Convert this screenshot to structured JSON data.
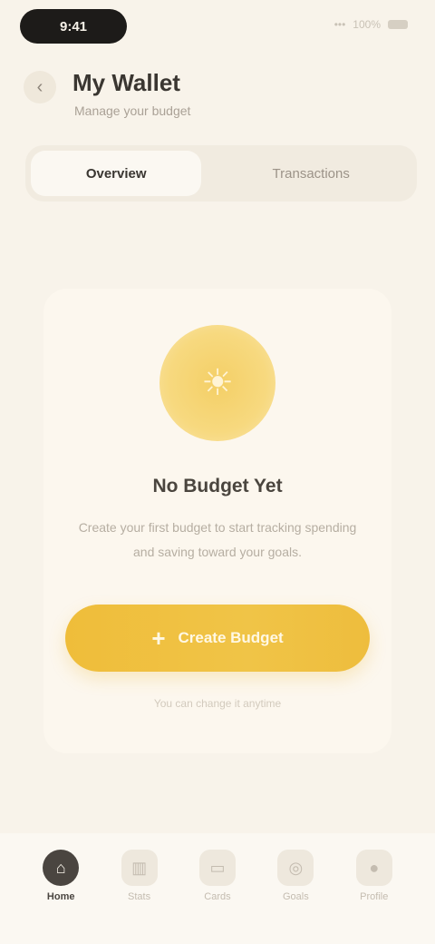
{
  "status": {
    "time": "9:41",
    "signal": "•••",
    "battery": "100%"
  },
  "header": {
    "back_icon": "chevron-left-icon",
    "title": "My Wallet",
    "subtitle": "Manage your budget"
  },
  "tabs": [
    {
      "label": "Overview",
      "active": true
    },
    {
      "label": "Transactions",
      "active": false
    }
  ],
  "empty_state": {
    "icon": "sun-icon",
    "title": "No Budget Yet",
    "description": "Create your first budget to start tracking spending and saving toward your goals.",
    "cta_label": "Create Budget",
    "cta_icon": "plus-icon",
    "note": "You can change it anytime"
  },
  "nav": [
    {
      "label": "Home",
      "icon": "home-icon",
      "active": true
    },
    {
      "label": "Stats",
      "icon": "chart-icon",
      "active": false
    },
    {
      "label": "Cards",
      "icon": "card-icon",
      "active": false
    },
    {
      "label": "Goals",
      "icon": "target-icon",
      "active": false
    },
    {
      "label": "Profile",
      "icon": "user-icon",
      "active": false
    }
  ],
  "colors": {
    "accent": "#efbd3a",
    "background": "#f8f3ea",
    "dark": "#1d1b19"
  }
}
